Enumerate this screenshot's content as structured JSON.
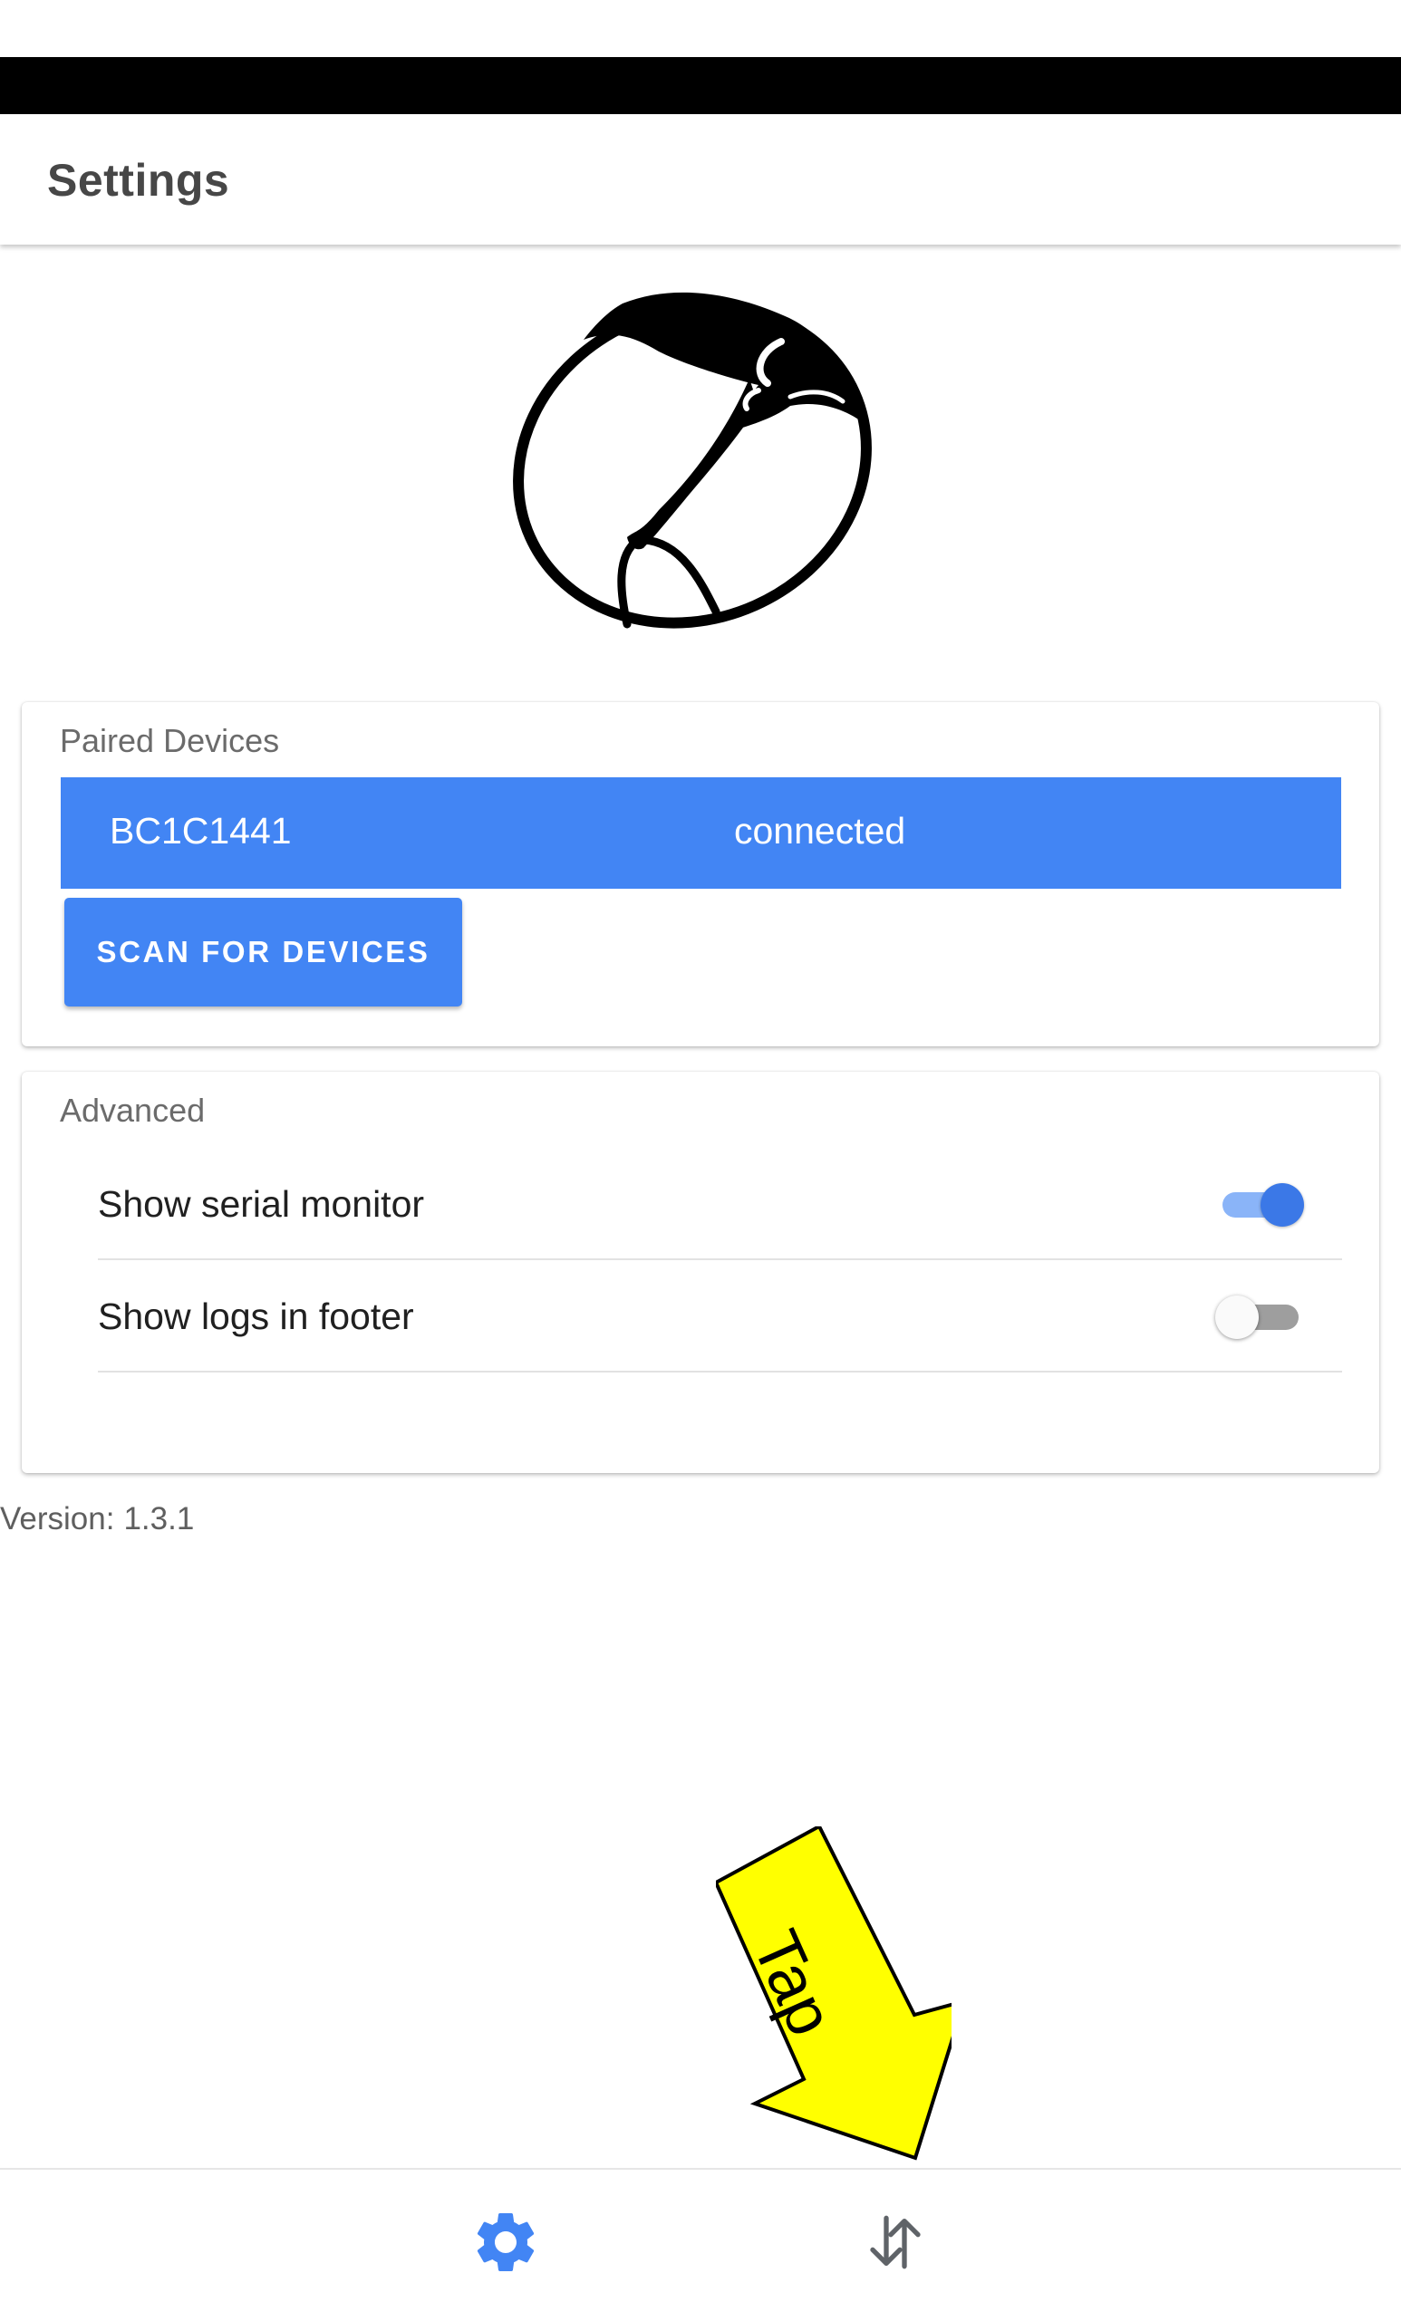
{
  "header": {
    "title": "Settings"
  },
  "paired_devices": {
    "title": "Paired Devices",
    "devices": [
      {
        "name": "BC1C1441",
        "status": "connected"
      }
    ],
    "scan_button_label": "SCAN FOR DEVICES"
  },
  "advanced": {
    "title": "Advanced",
    "settings": [
      {
        "label": "Show serial monitor",
        "enabled": true
      },
      {
        "label": "Show logs in footer",
        "enabled": false
      }
    ]
  },
  "version": {
    "label": "Version:",
    "value": "1.3.1"
  },
  "annotation": {
    "label": "Tap",
    "color": "#ffff00"
  },
  "bottom_nav": {
    "items": [
      {
        "icon": "gear-icon",
        "active": true,
        "color": "#4285f4"
      },
      {
        "icon": "swap-vertical-icon",
        "active": false,
        "color": "#5f6368"
      }
    ]
  },
  "colors": {
    "accent": "#4285f4"
  }
}
